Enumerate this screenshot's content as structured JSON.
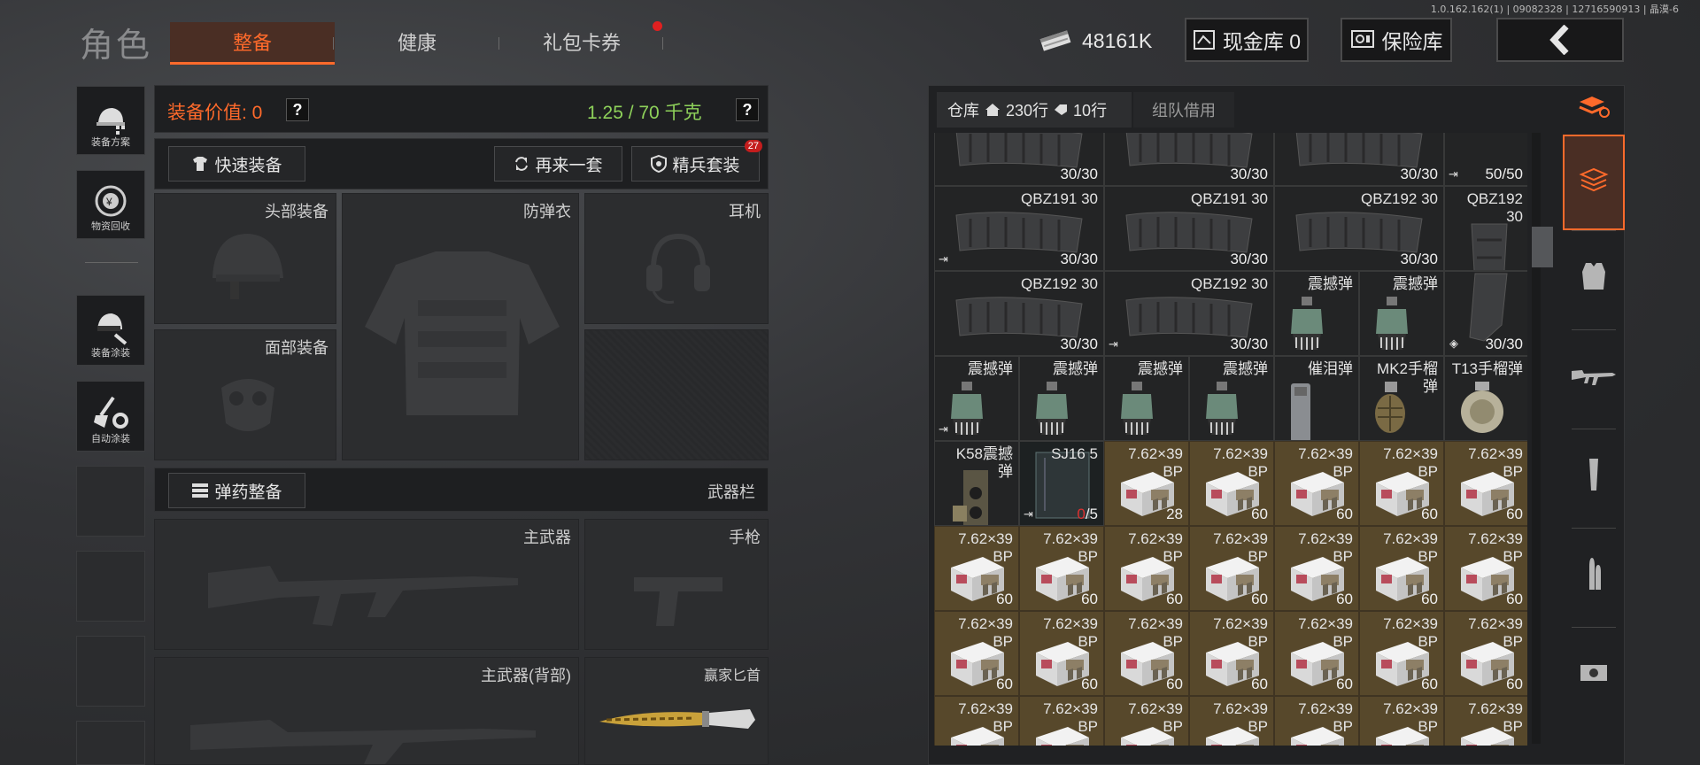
{
  "version_text": "1.0.162.162(1) | 09082328 | 12716590913 | 晶漠-6",
  "page_title": "角色",
  "tabs": [
    {
      "label": "整备",
      "active": true
    },
    {
      "label": "健康",
      "active": false
    },
    {
      "label": "礼包卡券",
      "active": false,
      "badge_dot": true
    }
  ],
  "topbar": {
    "currency_value": "48161K",
    "cash_vault_label": "现金库 0",
    "safe_box_label": "保险库",
    "back_icon": "chevron-left-icon"
  },
  "left_nav": [
    {
      "label": "装备方案",
      "icon": "helmet-plan-icon"
    },
    {
      "label": "物资回收",
      "icon": "recycle-icon"
    },
    {
      "label": "装备涂装",
      "icon": "helmet-paint-icon"
    },
    {
      "label": "自动涂装",
      "icon": "brush-gear-icon"
    }
  ],
  "loadout": {
    "value_label": "装备价值: 0",
    "weight_label": "1.25 / 70 千克",
    "help": "?",
    "quick_equip": "快速装备",
    "again_set": "再来一套",
    "elite_set": "精兵套装",
    "elite_badge": "27",
    "slots": {
      "head": "头部装备",
      "armor": "防弹衣",
      "headset": "耳机",
      "face": "面部装备"
    },
    "ammo_prep": "弹药整备",
    "weapon_bar": "武器栏",
    "primary": "主武器",
    "pistol": "手枪",
    "primary_back": "主武器(背部)",
    "melee": "赢家匕首"
  },
  "storage": {
    "tab_storage": "仓库",
    "rows_label": "230行",
    "tag_label": "10行",
    "tab_team": "组队借用"
  },
  "grid_rows": [
    [
      {
        "name": "",
        "count": "30/30",
        "k": "mag"
      },
      {
        "name": "",
        "count": "30/30",
        "k": "mag"
      },
      {
        "name": "",
        "count": "30/30",
        "k": "mag"
      },
      {
        "name": "",
        "count": "50/50",
        "k": "drum",
        "exit": true
      }
    ],
    [
      {
        "name": "QBZ191 30",
        "count": "30/30",
        "k": "mag",
        "exit": true
      },
      {
        "name": "QBZ191 30",
        "count": "30/30",
        "k": "mag"
      },
      {
        "name": "QBZ192 30",
        "count": "30/30",
        "k": "mag"
      },
      {
        "name": "QBZ192\n30",
        "count": "",
        "k": "magv"
      }
    ],
    [
      {
        "name": "QBZ192 30",
        "count": "30/30",
        "k": "mag"
      },
      {
        "name": "QBZ192 30",
        "count": "30/30",
        "k": "mag",
        "exit": true
      },
      {
        "name": "震撼弹",
        "count": "",
        "k": "gren"
      },
      {
        "name": "震撼弹",
        "count": "",
        "k": "gren"
      },
      {
        "name": "",
        "count": "30/30",
        "k": "magv2",
        "box": true
      }
    ],
    [
      {
        "name": "震撼弹",
        "count": "",
        "k": "gren",
        "exit": true
      },
      {
        "name": "震撼弹",
        "count": "",
        "k": "gren"
      },
      {
        "name": "震撼弹",
        "count": "",
        "k": "gren"
      },
      {
        "name": "震撼弹",
        "count": "",
        "k": "gren"
      },
      {
        "name": "催泪弹",
        "count": "",
        "k": "tear"
      },
      {
        "name": "MK2手榴\n弹",
        "count": "",
        "k": "mk2"
      },
      {
        "name": "T13手榴弹",
        "count": "",
        "k": "t13"
      }
    ],
    [
      {
        "name": "K58震撼\n弹",
        "count": "",
        "k": "k58"
      },
      {
        "name": "SJ16 5",
        "count": "0/5",
        "k": "clear",
        "exit": true
      },
      {
        "name": "7.62×39\nBP",
        "count": "28",
        "k": "ammo"
      },
      {
        "name": "7.62×39\nBP",
        "count": "60",
        "k": "ammo"
      },
      {
        "name": "7.62×39\nBP",
        "count": "60",
        "k": "ammo"
      },
      {
        "name": "7.62×39\nBP",
        "count": "60",
        "k": "ammo"
      },
      {
        "name": "7.62×39\nBP",
        "count": "60",
        "k": "ammo"
      }
    ],
    [
      {
        "name": "7.62×39\nBP",
        "count": "60",
        "k": "ammo"
      },
      {
        "name": "7.62×39\nBP",
        "count": "60",
        "k": "ammo"
      },
      {
        "name": "7.62×39\nBP",
        "count": "60",
        "k": "ammo"
      },
      {
        "name": "7.62×39\nBP",
        "count": "60",
        "k": "ammo"
      },
      {
        "name": "7.62×39\nBP",
        "count": "60",
        "k": "ammo"
      },
      {
        "name": "7.62×39\nBP",
        "count": "60",
        "k": "ammo"
      },
      {
        "name": "7.62×39\nBP",
        "count": "60",
        "k": "ammo"
      }
    ],
    [
      {
        "name": "7.62×39\nBP",
        "count": "60",
        "k": "ammo"
      },
      {
        "name": "7.62×39\nBP",
        "count": "60",
        "k": "ammo"
      },
      {
        "name": "7.62×39\nBP",
        "count": "60",
        "k": "ammo"
      },
      {
        "name": "7.62×39\nBP",
        "count": "60",
        "k": "ammo"
      },
      {
        "name": "7.62×39\nBP",
        "count": "60",
        "k": "ammo"
      },
      {
        "name": "7.62×39\nBP",
        "count": "60",
        "k": "ammo"
      },
      {
        "name": "7.62×39\nBP",
        "count": "60",
        "k": "ammo"
      }
    ],
    [
      {
        "name": "7.62×39\nBP",
        "count": "",
        "k": "ammo"
      },
      {
        "name": "7.62×39\nBP",
        "count": "",
        "k": "ammo"
      },
      {
        "name": "7.62×39\nBP",
        "count": "",
        "k": "ammo"
      },
      {
        "name": "7.62×39\nBP",
        "count": "",
        "k": "ammo"
      },
      {
        "name": "7.62×39\nBP",
        "count": "",
        "k": "ammo"
      },
      {
        "name": "7.62×39\nBP",
        "count": "",
        "k": "ammo"
      },
      {
        "name": "7.62×39\nBP",
        "count": "",
        "k": "ammo"
      }
    ]
  ],
  "right_tabs": [
    "stack-refresh-icon",
    "stack-icon",
    "vest-icon",
    "rifle-icon",
    "magazine-icon",
    "bullet-icon",
    "sight-icon"
  ],
  "colors": {
    "accent": "#ff6a2b",
    "weight_green": "#8ed15a",
    "gold_cell": "#57482b"
  }
}
